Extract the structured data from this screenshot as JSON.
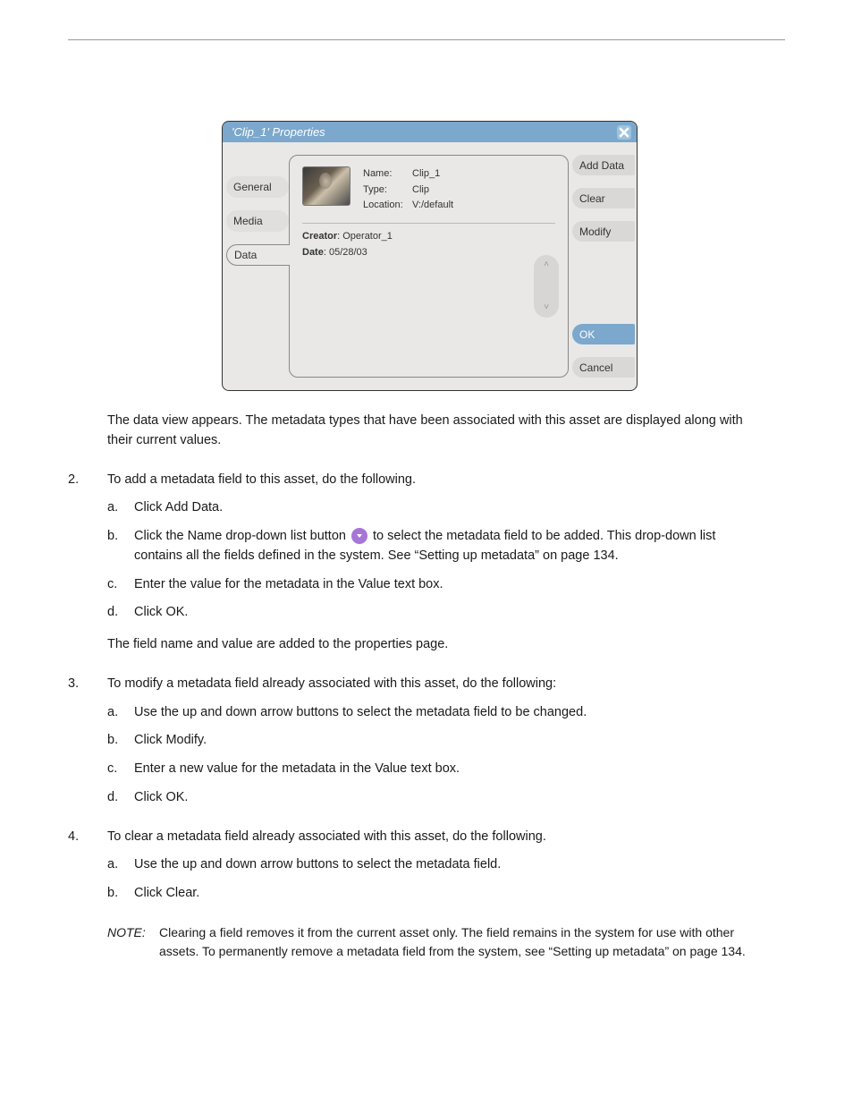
{
  "dialog": {
    "title": "'Clip_1' Properties",
    "tabs": {
      "general": "General",
      "media": "Media",
      "data": "Data"
    },
    "fields": {
      "name_lbl": "Name:",
      "name_val": "Clip_1",
      "type_lbl": "Type:",
      "type_val": "Clip",
      "location_lbl": "Location:",
      "location_val": "V:/default"
    },
    "lines": {
      "creator_lbl": "Creator",
      "creator_val": ": Operator_1",
      "date_lbl": "Date",
      "date_val": ": 05/28/03"
    },
    "buttons": {
      "add_data": "Add Data",
      "clear": "Clear",
      "modify": "Modify",
      "ok": "OK",
      "cancel": "Cancel"
    }
  },
  "doc": {
    "p1": "The data view appears. The metadata types that have been associated with this asset are displayed along with their current values.",
    "s2n": "2.",
    "s2": "To add a metadata field to this asset, do the following.",
    "s2a_n": "a.",
    "s2a": "Click Add Data.",
    "s2b_n": "b.",
    "s2b_pre": "Click the Name drop-down list button ",
    "s2b_post": " to select the metadata field to be added. This drop-down list contains all the fields defined in the system. See “Setting up metadata” on page 134.",
    "s2c_n": "c.",
    "s2c": "Enter the value for the metadata in the Value text box.",
    "s2d_n": "d.",
    "s2d": "Click OK.",
    "s2e": "The field name and value are added to the properties page.",
    "s3n": "3.",
    "s3": "To modify a metadata field already associated with this asset, do the following:",
    "s3a_n": "a.",
    "s3a": "Use the up and down arrow buttons to select the metadata field to be changed.",
    "s3b_n": "b.",
    "s3b": "Click Modify.",
    "s3c_n": "c.",
    "s3c": "Enter a new value for the metadata in the Value text box.",
    "s3d_n": "d.",
    "s3d": "Click OK.",
    "s4n": "4.",
    "s4": "To clear a metadata field already associated with this asset, do the following.",
    "s4a_n": "a.",
    "s4a": "Use the up and down arrow buttons to select the metadata field.",
    "s4b_n": "b.",
    "s4b": "Click Clear.",
    "note_lbl": "NOTE:",
    "note": "Clearing a field removes it from the current asset only. The field remains in the system for use with other assets. To permanently remove a metadata field from the system, see “Setting up metadata” on page 134."
  }
}
